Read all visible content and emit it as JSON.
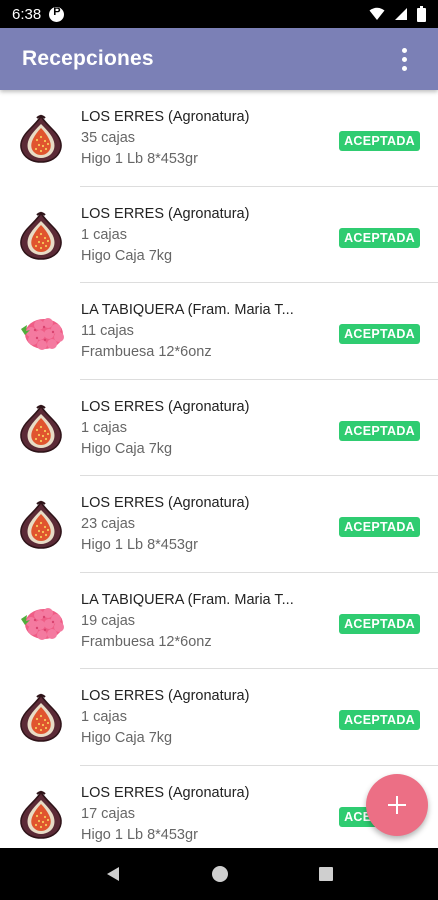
{
  "status_bar": {
    "time": "6:38",
    "icons": [
      "app-notification-icon",
      "wifi-icon",
      "signal-icon",
      "battery-icon"
    ]
  },
  "app_bar": {
    "title": "Recepciones",
    "menu_icon": "more-vert-icon"
  },
  "colors": {
    "app_bar": "#7b80b6",
    "badge": "#2fcc71",
    "fab": "#ec6f85"
  },
  "receptions": [
    {
      "supplier": "LOS ERRES (Agronatura)",
      "quantity": "35 cajas",
      "product": "Higo 1 Lb 8*453gr",
      "status": "ACEPTADA",
      "fruit": "fig"
    },
    {
      "supplier": "LOS ERRES (Agronatura)",
      "quantity": "1 cajas",
      "product": "Higo Caja 7kg",
      "status": "ACEPTADA",
      "fruit": "fig"
    },
    {
      "supplier": "LA TABIQUERA (Fram. Maria T...",
      "quantity": "11 cajas",
      "product": "Frambuesa 12*6onz",
      "status": "ACEPTADA",
      "fruit": "raspberry"
    },
    {
      "supplier": "LOS ERRES (Agronatura)",
      "quantity": "1 cajas",
      "product": "Higo Caja 7kg",
      "status": "ACEPTADA",
      "fruit": "fig"
    },
    {
      "supplier": "LOS ERRES (Agronatura)",
      "quantity": "23 cajas",
      "product": "Higo 1 Lb 8*453gr",
      "status": "ACEPTADA",
      "fruit": "fig"
    },
    {
      "supplier": "LA TABIQUERA (Fram. Maria T...",
      "quantity": "19 cajas",
      "product": "Frambuesa 12*6onz",
      "status": "ACEPTADA",
      "fruit": "raspberry"
    },
    {
      "supplier": "LOS ERRES (Agronatura)",
      "quantity": "1 cajas",
      "product": "Higo Caja 7kg",
      "status": "ACEPTADA",
      "fruit": "fig"
    },
    {
      "supplier": "LOS ERRES (Agronatura)",
      "quantity": "17 cajas",
      "product": "Higo 1 Lb 8*453gr",
      "status": "ACEPTADA",
      "fruit": "fig"
    }
  ],
  "fab": {
    "icon": "add-icon"
  },
  "nav_bar": {
    "icons": [
      "back-icon",
      "home-icon",
      "recents-icon"
    ]
  }
}
